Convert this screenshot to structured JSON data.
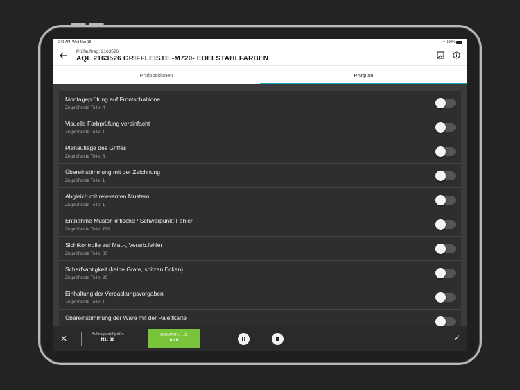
{
  "status": {
    "time": "9:41 AM",
    "date": "Wed Mar 18",
    "battery": "100%"
  },
  "header": {
    "subtitle": "Prüfauftrag: 2163526",
    "title": "AQL 2163526  GRIFFLEISTE -M720- EDELSTAHLFARBEN"
  },
  "tabs": [
    {
      "label": "Prüfpositionen",
      "active": false
    },
    {
      "label": "Prüfplan",
      "active": true
    }
  ],
  "items": [
    {
      "title": "Montageprüfung auf Frontschablone",
      "sub": "Zu prüfende Teile: 4"
    },
    {
      "title": "Visuelle Farbprüfung vereinfacht",
      "sub": "Zu prüfende Teile: 1"
    },
    {
      "title": "Planauflage des Griffes",
      "sub": "Zu prüfende Teile: 8"
    },
    {
      "title": "Übereinstimmung mit der Zeichnung",
      "sub": "Zu prüfende Teile: 1"
    },
    {
      "title": "Abgleich mit relevanten Mustern",
      "sub": "Zu prüfende Teile: 1"
    },
    {
      "title": "Entnahme Muster kritische / Schwerpunkt-Fehler",
      "sub": "Zu prüfende Teile: 799"
    },
    {
      "title": "Sichtkontrolle auf Mat.-, Verarb.fehler",
      "sub": "Zu prüfende Teile: 80"
    },
    {
      "title": "Scharfkantigkeit (keine Grate, spitzen Ecken)",
      "sub": "Zu prüfende Teile: 80"
    },
    {
      "title": "Einhaltung der Verpackungsvorgaben",
      "sub": "Zu prüfende Teile: 1"
    },
    {
      "title": "Übereinstimmung der Ware mit der Palettkarte",
      "sub": ""
    }
  ],
  "bottom": {
    "auftrag_label": "Auftragsprüfgröße",
    "auftrag_value": "N1: 80",
    "gesamt_label": "GESAMT n.i.O.",
    "gesamt_value": "0 / 9"
  },
  "colors": {
    "accent": "#16a6c1",
    "gesamt": "#79c43b"
  }
}
